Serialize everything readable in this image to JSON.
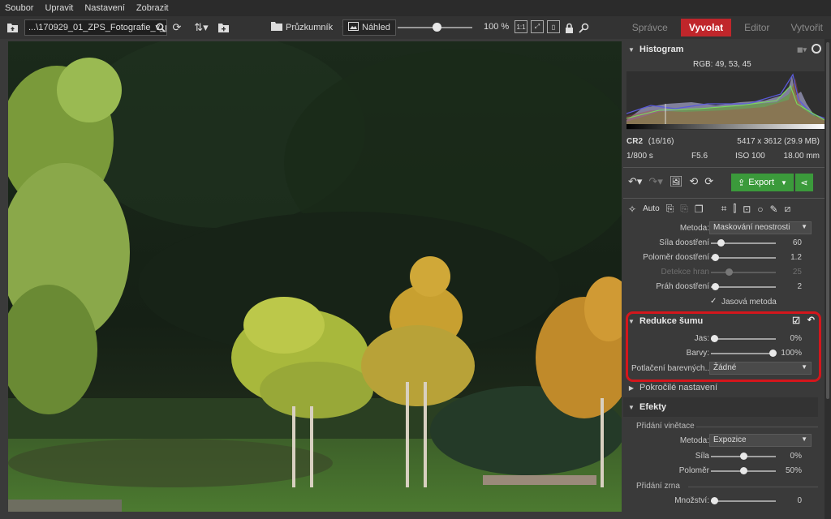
{
  "menu": [
    "Soubor",
    "Upravit",
    "Nastavení",
    "Zobrazit"
  ],
  "toolbar": {
    "path": "...\\170929_01_ZPS_Fotografie_v_proti",
    "browser_label": "Průzkumník",
    "preview_label": "Náhled",
    "zoom_label": "100 %",
    "zoom_value": 0.5,
    "one_to_one": "1:1"
  },
  "tabs": [
    "Správce",
    "Vyvolat",
    "Editor",
    "Vytvořit"
  ],
  "active_tab": "Vyvolat",
  "histogram": {
    "title": "Histogram",
    "rgb": "RGB: 49, 53, 45",
    "file_type": "CR2",
    "index": "(16/16)",
    "dimensions": "5417 x 3612 (29.9 MB)",
    "shutter": "1/800 s",
    "aperture": "F5.6",
    "iso": "ISO 100",
    "focal": "18.00 mm"
  },
  "actions": {
    "export_label": "Export"
  },
  "tools": {
    "auto_label": "Auto"
  },
  "sharpen": {
    "method_label": "Metoda:",
    "method_value": "Maskování neostrosti",
    "rows": [
      {
        "label": "Síla doostření",
        "value": "60",
        "pos": 0.12
      },
      {
        "label": "Poloměr doostření",
        "value": "1.2",
        "pos": 0.05
      },
      {
        "label": "Detekce hran",
        "value": "25",
        "pos": 0.28
      },
      {
        "label": "Práh doostření",
        "value": "2",
        "pos": 0.05
      }
    ],
    "luma_label": "Jasová metoda"
  },
  "noise": {
    "title": "Redukce šumu",
    "rows": [
      {
        "label": "Jas:",
        "value": "0%",
        "pos": 0.0
      },
      {
        "label": "Barvy:",
        "value": "100%",
        "pos": 0.95
      }
    ],
    "suppress_label": "Potlačení barevných...",
    "suppress_value": "Žádné"
  },
  "advanced": {
    "title": "Pokročilé nastavení"
  },
  "effects": {
    "title": "Efekty",
    "vignette_title": "Přidání vinětace",
    "method_label": "Metoda:",
    "method_value": "Expozice",
    "rows": [
      {
        "label": "Síla",
        "value": "0%",
        "pos": 0.5
      },
      {
        "label": "Poloměr",
        "value": "50%",
        "pos": 0.5
      }
    ],
    "grain_title": "Přidání zrna",
    "grain_rows": [
      {
        "label": "Množství:",
        "value": "0",
        "pos": 0.0
      }
    ]
  },
  "colors": {
    "accent": "#c0262b",
    "export": "#3b9a3b",
    "highlight": "#d4161c"
  }
}
